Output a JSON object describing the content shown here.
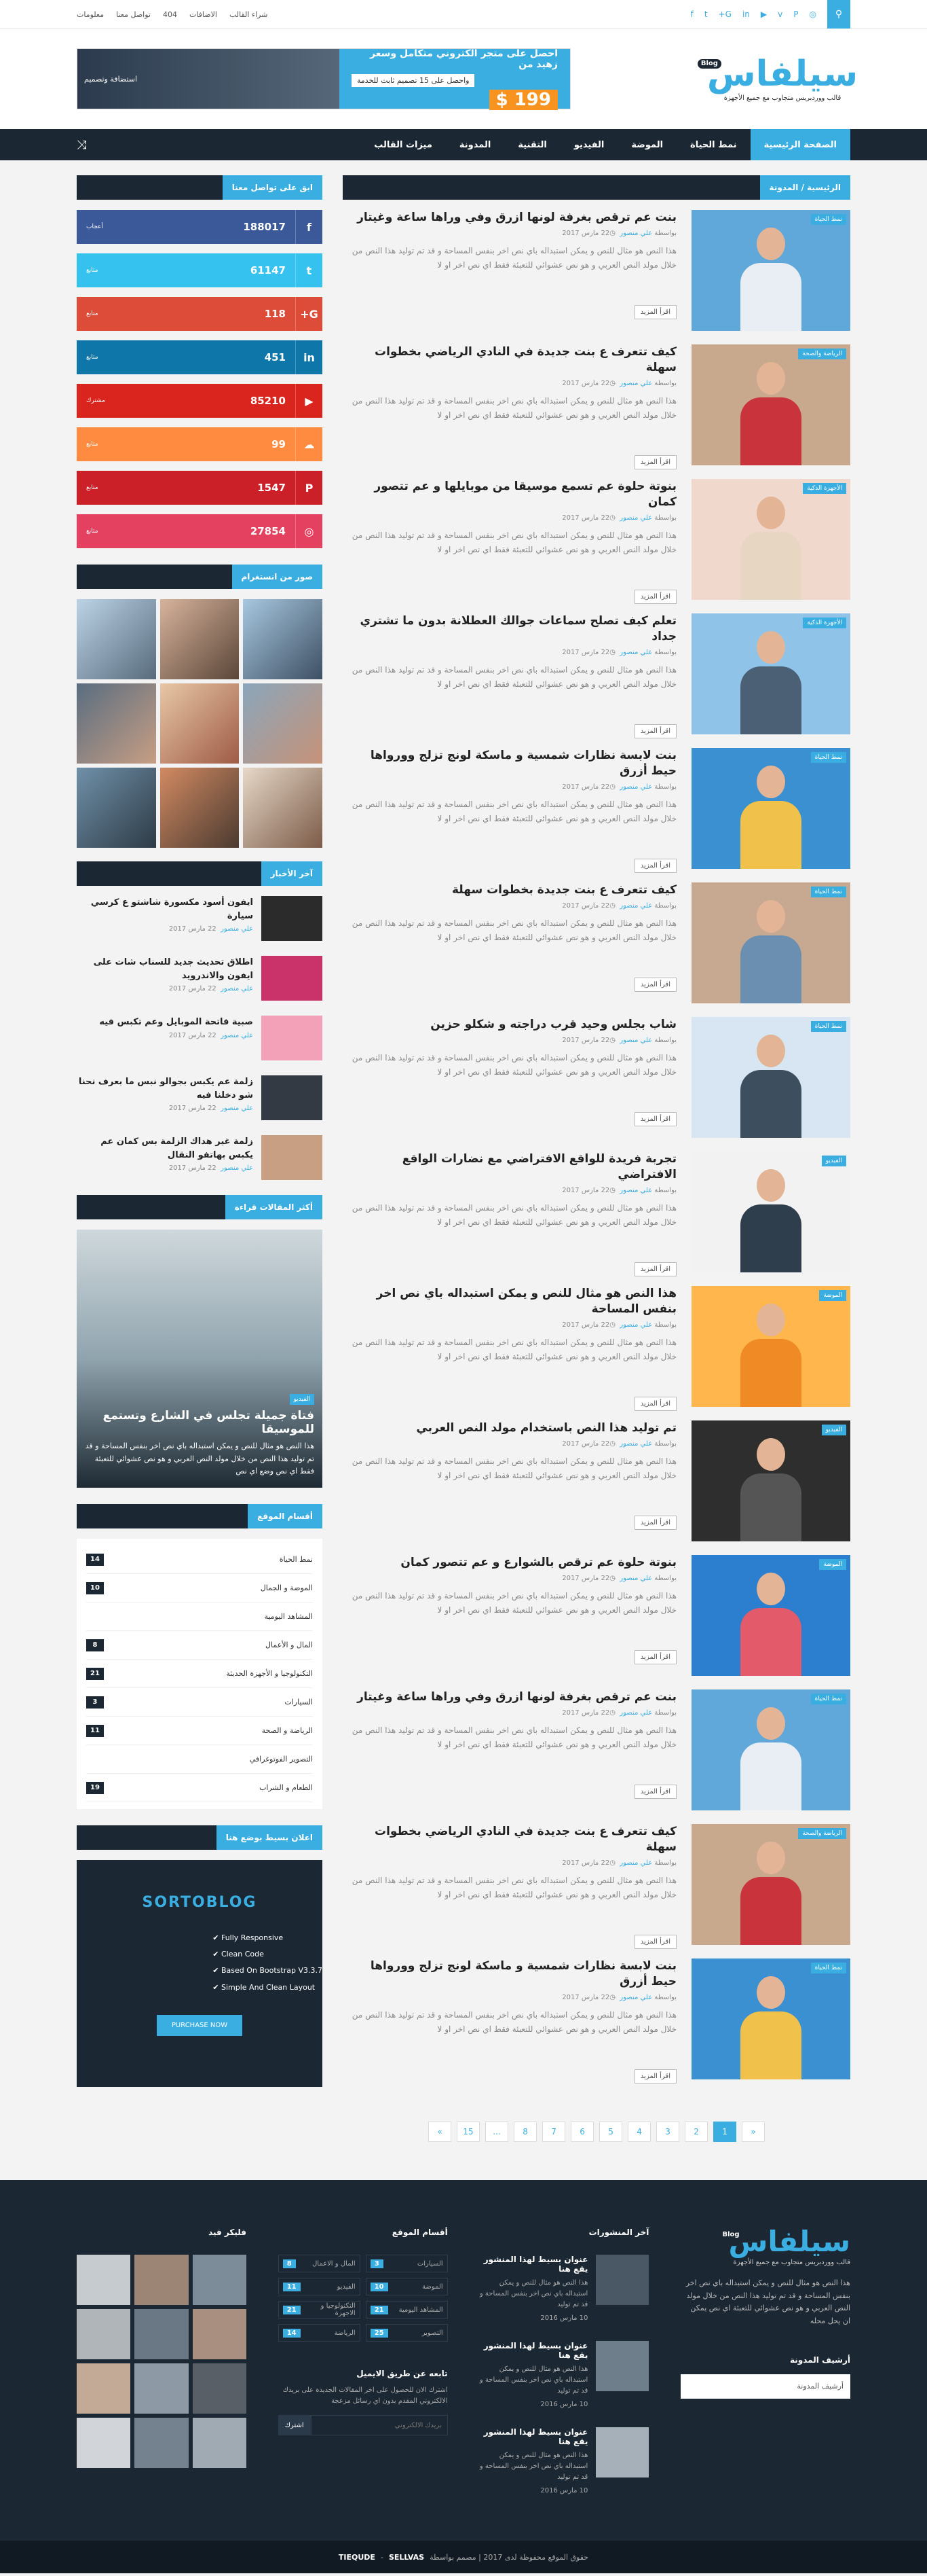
{
  "topbar": {
    "links": [
      "معلومات",
      "تواصل معنا",
      "404",
      "الاضافات",
      "شراء القالب"
    ],
    "social_icons": [
      "facebook-icon",
      "twitter-icon",
      "google-plus-icon",
      "linkedin-icon",
      "youtube-icon",
      "vimeo-icon",
      "pinterest-icon",
      "instagram-icon"
    ]
  },
  "logo": {
    "name": "سيلفاس",
    "badge": "Blog",
    "tagline": "قالب ووردبريس متجاوب مع جميع الأجهزة"
  },
  "banner": {
    "line1": "احصل على متجر الكتروني متكامل وسعر زهيد من",
    "line2": "واحصل على 15 تصميم ثابت للخدمة",
    "price": "199 $",
    "right": "استضافة وتصميم"
  },
  "nav": {
    "items": [
      "الصفحة الرئيسية",
      "نمط الحياة",
      "الموضة",
      "الفيديو",
      "التقنية",
      "المدونة",
      "ميزات القالب"
    ]
  },
  "breadcrumb": "الرئيسية / المدونة",
  "posts": [
    {
      "title": "بنت عم ترقص بغرفة لونها ازرق وفي وراها ساعة وغيتار",
      "tag": "نمط الحياة",
      "meta_by": "بواسطة",
      "author": "علي منصور",
      "date": "22 مارس 2017",
      "excerpt": "هذا النص هو مثال للنص و يمكن استبداله باي نص اخر بنفس المساحة و قد تم توليد هذا النص من خلال مولد النص العربي و هو نص عشوائي للتعبئة فقط اي نص اخر او لا",
      "more": "اقرأ المزيد"
    },
    {
      "title": "كيف تتعرف ع بنت جديدة في النادي الرياضي بخطوات سهلة",
      "tag": "الرياضة والصحة",
      "meta_by": "بواسطة",
      "author": "علي منصور",
      "date": "22 مارس 2017",
      "excerpt": "هذا النص هو مثال للنص و يمكن استبداله باي نص اخر بنفس المساحة و قد تم توليد هذا النص من خلال مولد النص العربي و هو نص عشوائي للتعبئة فقط اي نص اخر او لا",
      "more": "اقرأ المزيد"
    },
    {
      "title": "بنوتة حلوة عم تسمع موسيقا من موبايلها و عم تتصور كمان",
      "tag": "الأجهزة الذكية",
      "meta_by": "بواسطة",
      "author": "علي منصور",
      "date": "22 مارس 2017",
      "excerpt": "هذا النص هو مثال للنص و يمكن استبداله باي نص اخر بنفس المساحة و قد تم توليد هذا النص من خلال مولد النص العربي و هو نص عشوائي للتعبئة فقط اي نص اخر او لا",
      "more": "اقرأ المزيد"
    },
    {
      "title": "تعلم كيف تصلح سماعات جوالك العطلانة بدون ما تشتري جداد",
      "tag": "الأجهزة الذكية",
      "meta_by": "بواسطة",
      "author": "علي منصور",
      "date": "22 مارس 2017",
      "excerpt": "هذا النص هو مثال للنص و يمكن استبداله باي نص اخر بنفس المساحة و قد تم توليد هذا النص من خلال مولد النص العربي و هو نص عشوائي للتعبئة فقط اي نص اخر او لا",
      "more": "اقرأ المزيد"
    },
    {
      "title": "بنت لابسة نظارات شمسية و ماسكة لونج تزلج وورواها حيط أزرق",
      "tag": "نمط الحياة",
      "meta_by": "بواسطة",
      "author": "علي منصور",
      "date": "22 مارس 2017",
      "excerpt": "هذا النص هو مثال للنص و يمكن استبداله باي نص اخر بنفس المساحة و قد تم توليد هذا النص من خلال مولد النص العربي و هو نص عشوائي للتعبئة فقط اي نص اخر او لا",
      "more": "اقرأ المزيد"
    },
    {
      "title": "كيف تتعرف ع بنت جديدة بخطوات سهلة",
      "tag": "نمط الحياة",
      "meta_by": "بواسطة",
      "author": "علي منصور",
      "date": "22 مارس 2017",
      "excerpt": "هذا النص هو مثال للنص و يمكن استبداله باي نص اخر بنفس المساحة و قد تم توليد هذا النص من خلال مولد النص العربي و هو نص عشوائي للتعبئة فقط اي نص اخر او لا",
      "more": "اقرأ المزيد"
    },
    {
      "title": "شاب بجلس وحيد قرب دراجته و شكلو حزين",
      "tag": "نمط الحياة",
      "meta_by": "بواسطة",
      "author": "علي منصور",
      "date": "22 مارس 2017",
      "excerpt": "هذا النص هو مثال للنص و يمكن استبداله باي نص اخر بنفس المساحة و قد تم توليد هذا النص من خلال مولد النص العربي و هو نص عشوائي للتعبئة فقط اي نص اخر او لا",
      "more": "اقرأ المزيد"
    },
    {
      "title": "تجربة فريدة للواقع الافتراضي مع نضارات الواقع الافتراضي",
      "tag": "الفيديو",
      "meta_by": "بواسطة",
      "author": "علي منصور",
      "date": "22 مارس 2017",
      "excerpt": "هذا النص هو مثال للنص و يمكن استبداله باي نص اخر بنفس المساحة و قد تم توليد هذا النص من خلال مولد النص العربي و هو نص عشوائي للتعبئة فقط اي نص اخر او لا",
      "more": "اقرأ المزيد"
    },
    {
      "title": "هذا النص هو مثال للنص و يمكن استبداله باي نص اخر بنفس المساحة",
      "tag": "الموضة",
      "meta_by": "بواسطة",
      "author": "علي منصور",
      "date": "22 مارس 2017",
      "excerpt": "هذا النص هو مثال للنص و يمكن استبداله باي نص اخر بنفس المساحة و قد تم توليد هذا النص من خلال مولد النص العربي و هو نص عشوائي للتعبئة فقط اي نص اخر او لا",
      "more": "اقرأ المزيد"
    },
    {
      "title": "تم توليد هذا النص باستخدام مولد النص العربي",
      "tag": "الفيديو",
      "meta_by": "بواسطة",
      "author": "علي منصور",
      "date": "22 مارس 2017",
      "excerpt": "هذا النص هو مثال للنص و يمكن استبداله باي نص اخر بنفس المساحة و قد تم توليد هذا النص من خلال مولد النص العربي و هو نص عشوائي للتعبئة فقط اي نص اخر او لا",
      "more": "اقرأ المزيد"
    },
    {
      "title": "بنوتة حلوة عم ترقص بالشوارع و عم تتصور كمان",
      "tag": "الموضة",
      "meta_by": "بواسطة",
      "author": "علي منصور",
      "date": "22 مارس 2017",
      "excerpt": "هذا النص هو مثال للنص و يمكن استبداله باي نص اخر بنفس المساحة و قد تم توليد هذا النص من خلال مولد النص العربي و هو نص عشوائي للتعبئة فقط اي نص اخر او لا",
      "more": "اقرأ المزيد"
    },
    {
      "title": "بنت عم ترقص بغرفة لونها ازرق وفي وراها ساعة وغيتار",
      "tag": "نمط الحياة",
      "meta_by": "بواسطة",
      "author": "علي منصور",
      "date": "22 مارس 2017",
      "excerpt": "هذا النص هو مثال للنص و يمكن استبداله باي نص اخر بنفس المساحة و قد تم توليد هذا النص من خلال مولد النص العربي و هو نص عشوائي للتعبئة فقط اي نص اخر او لا",
      "more": "اقرأ المزيد"
    },
    {
      "title": "كيف تتعرف ع بنت جديدة في النادي الرياضي بخطوات سهلة",
      "tag": "الرياضة والصحة",
      "meta_by": "بواسطة",
      "author": "علي منصور",
      "date": "22 مارس 2017",
      "excerpt": "هذا النص هو مثال للنص و يمكن استبداله باي نص اخر بنفس المساحة و قد تم توليد هذا النص من خلال مولد النص العربي و هو نص عشوائي للتعبئة فقط اي نص اخر او لا",
      "more": "اقرأ المزيد"
    },
    {
      "title": "بنت لابسة نظارات شمسية و ماسكة لونج تزلج وورواها حيط أزرق",
      "tag": "نمط الحياة",
      "meta_by": "بواسطة",
      "author": "علي منصور",
      "date": "22 مارس 2017",
      "excerpt": "هذا النص هو مثال للنص و يمكن استبداله باي نص اخر بنفس المساحة و قد تم توليد هذا النص من خلال مولد النص العربي و هو نص عشوائي للتعبئة فقط اي نص اخر او لا",
      "more": "اقرأ المزيد"
    }
  ],
  "pagination": [
    "1",
    "2",
    "3",
    "4",
    "5",
    "6",
    "7",
    "8",
    "...",
    "15",
    "«",
    "»"
  ],
  "sidebar": {
    "social_title": "ابق على تواصل معنا",
    "social": [
      {
        "icon": "facebook-icon",
        "glyph": "f",
        "count": "188017",
        "label": "أعجاب",
        "color": "#3b5998"
      },
      {
        "icon": "twitter-icon",
        "glyph": "t",
        "count": "61147",
        "label": "متابع",
        "color": "#35c2ee"
      },
      {
        "icon": "google-plus-icon",
        "glyph": "G+",
        "count": "118",
        "label": "متابع",
        "color": "#dd4b39"
      },
      {
        "icon": "linkedin-icon",
        "glyph": "in",
        "count": "451",
        "label": "متابع",
        "color": "#0e76a8"
      },
      {
        "icon": "youtube-icon",
        "glyph": "▶",
        "count": "85210",
        "label": "مشترك",
        "color": "#d9251d"
      },
      {
        "icon": "soundcloud-icon",
        "glyph": "☁",
        "count": "99",
        "label": "متابع",
        "color": "#ff8b40"
      },
      {
        "icon": "pinterest-icon",
        "glyph": "P",
        "count": "1547",
        "label": "متابع",
        "color": "#cb2027"
      },
      {
        "icon": "instagram-icon",
        "glyph": "◎",
        "count": "27854",
        "label": "متابع",
        "color": "#e4405f"
      }
    ],
    "insta_title": "صور من انستغرام",
    "recent_title": "آخر الأخبار",
    "recent": [
      {
        "title": "ايفون أسود مكسورة شاشتو ع كرسي سيارة",
        "author": "علي منصور",
        "date": "22 مارس 2017"
      },
      {
        "title": "اطلاق تحديث جديد للسناب شات على ايفون والاندرويد",
        "author": "علي منصور",
        "date": "22 مارس 2017"
      },
      {
        "title": "صبية فاتحة الموبايل وعم تكبس فيه",
        "author": "علي منصور",
        "date": "22 مارس 2017"
      },
      {
        "title": "زلمة عم يكبس بجوالو نبس ما بعرف نحنا شو دخلنا فيه",
        "author": "علي منصور",
        "date": "22 مارس 2017"
      },
      {
        "title": "زلمة غير هداك الزلمة بس كمان عم يكبس بهاتفو النقال",
        "author": "علي منصور",
        "date": "22 مارس 2017"
      }
    ],
    "featured_title": "أكثر المقالات قراءة",
    "featured": {
      "tag": "الفيديو",
      "title": "فتاة جميلة تجلس في الشارع وتستمع للموسيقا",
      "excerpt": "هذا النص هو مثال للنص و يمكن استبداله باي نص اخر بنفس المساحة و قد تم توليد هذا النص من خلال مولد النص العربي و هو نص عشوائي للتعبئة فقط اي نص وضع اي نص"
    },
    "cats_title": "أقسام الموقع",
    "cats": [
      {
        "name": "نمط الحياة",
        "n": "14"
      },
      {
        "name": "الموضة و الجمال",
        "n": "10"
      },
      {
        "name": "المشاهد اليومية",
        "n": ""
      },
      {
        "name": "المال و الأعمال",
        "n": "8"
      },
      {
        "name": "التكنولوجيا و الأجهزة الحديثة",
        "n": "21"
      },
      {
        "name": "السيارات",
        "n": "3"
      },
      {
        "name": "الرياضة و الصحة",
        "n": "11"
      },
      {
        "name": "التصوير الفوتوغرافي",
        "n": ""
      },
      {
        "name": "الطعام و الشراب",
        "n": "19"
      }
    ],
    "ad_title": "اعلان بسيط بوضع هنا",
    "ad": {
      "name": "SORTOBLOG",
      "features": [
        "Fully Responsive",
        "Clean Code",
        "Based On Bootstrap V3.3.7",
        "Simple And Clean Layout"
      ],
      "button": "PURCHASE NOW"
    }
  },
  "footer": {
    "about": "هذا النص هو مثال للنص و يمكن استبداله باي نص اخر بنفس المساحة و قد تم توليد هذا النص من خلال مولد النص العربي و هو نص عشوائي للتعبئة اي نص يمكن ان يحل محله",
    "archive_label": "أرشيف المدونة",
    "archive_select": "أرشيف المدونة",
    "posts_title": "آخر المنشورات",
    "posts": [
      {
        "title": "عنوان بسيط لهذا المنشور يقع هنا",
        "excerpt": "هذا النص هو مثال للنص و يمكن استبداله باي نص اخر بنفس المساحة و قد تم توليد",
        "date": "10 مارس 2016"
      },
      {
        "title": "عنوان بسيط لهذا المنشور يقع هنا",
        "excerpt": "هذا النص هو مثال للنص و يمكن استبداله باي نص اخر بنفس المساحة و قد تم توليد",
        "date": "10 مارس 2016"
      },
      {
        "title": "عنوان بسيط لهذا المنشور يقع هنا",
        "excerpt": "هذا النص هو مثال للنص و يمكن استبداله باي نص اخر بنفس المساحة و قد تم توليد",
        "date": "10 مارس 2016"
      }
    ],
    "cats_title": "أقسام الموقع",
    "cats": [
      {
        "name": "السيارات",
        "n": "3"
      },
      {
        "name": "المال و الاعمال",
        "n": "8"
      },
      {
        "name": "الموضة",
        "n": "10"
      },
      {
        "name": "الفيديو",
        "n": "11"
      },
      {
        "name": "المشاهد اليومية",
        "n": "21"
      },
      {
        "name": "التكنولوجيا و الاجهزة",
        "n": "21"
      },
      {
        "name": "التصوير",
        "n": "25"
      },
      {
        "name": "الرياضة",
        "n": "14"
      }
    ],
    "subscribe_title": "تابعه عن طريق الايميل",
    "subscribe_text": "اشترك الان للحصول على اخر المقالات الجديدة على بريدك الالكتروني المقدم بدون اي رسائل مزعجة",
    "subscribe_placeholder": "بريدك الالكتروني",
    "subscribe_btn": "اشترك",
    "flickr_title": "فليكر فيد"
  },
  "bottom": {
    "text": "حقوق الموقع محفوظة لدى 2017 | مصمم بواسطة",
    "brand1": "SELLVAS",
    "brand2": "TIEQUDE"
  }
}
